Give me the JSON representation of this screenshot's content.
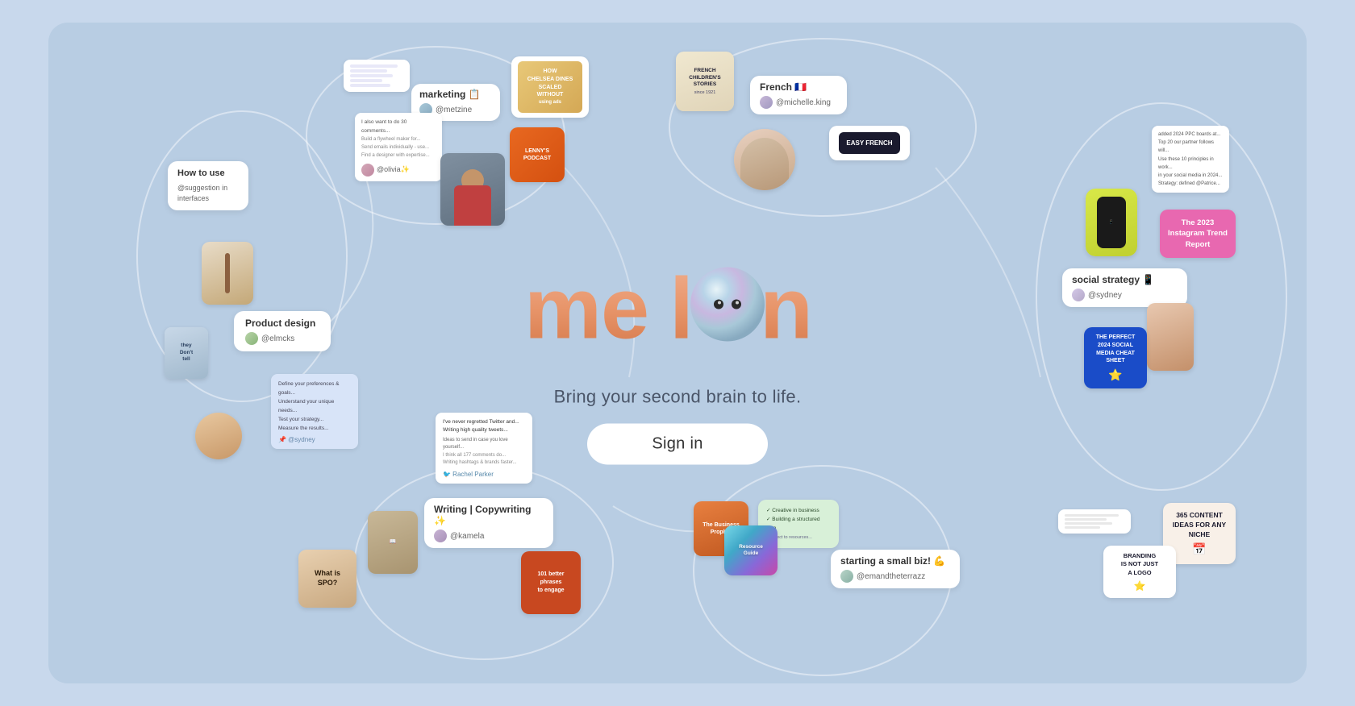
{
  "app": {
    "name": "Melon",
    "tagline": "Bring your second brain to life.",
    "signin_label": "Sign in",
    "logo_text": "melon"
  },
  "cards": {
    "marketing": {
      "label": "marketing 📋",
      "user": "@metzine"
    },
    "product_design": {
      "label": "Product design",
      "user": "@elmcks"
    },
    "how_to_use": {
      "label": "How to use",
      "sub": "@suggestion in interfaces"
    },
    "french": {
      "label": "French 🇫🇷",
      "user": "@michelle.king"
    },
    "social_strategy": {
      "label": "social strategy 📱",
      "user": "@sydney"
    },
    "starting_biz": {
      "label": "starting a small biz! 💪",
      "user": "@emandtheterrazz"
    },
    "writing": {
      "label": "Writing | Copywriting ✨",
      "user": "@kamela"
    },
    "trend_report": {
      "label": "The 2023 Instagram Trend Report"
    },
    "content_ideas": {
      "label": "365 CONTENT IDEAS FOR ANY NICHE"
    },
    "easy_french": {
      "label": "EASY FRENCH"
    }
  },
  "colors": {
    "bg": "#b8cde3",
    "card_bg": "#ffffff",
    "accent_peach": "#e8a882",
    "accent_blue": "#1a6fd4",
    "accent_pink": "#e879a0",
    "accent_orange": "#f5a623",
    "text_dark": "#333333",
    "text_mid": "#555555",
    "text_light": "#888888",
    "curve_color": "rgba(255,255,255,0.45)"
  }
}
